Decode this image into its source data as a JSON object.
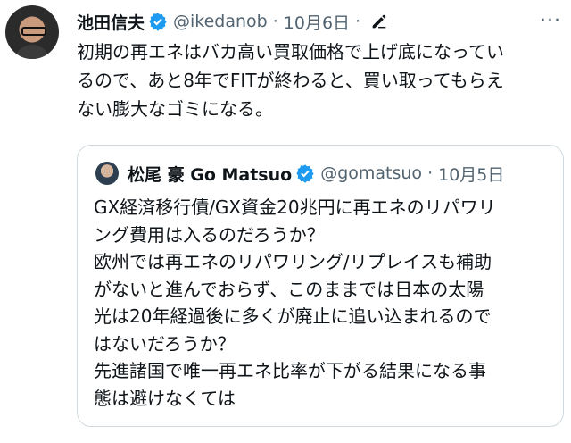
{
  "tweet": {
    "display_name": "池田信夫",
    "handle": "@ikedanob",
    "separator": "·",
    "date": "10月6日",
    "more_label": "···",
    "text_lines": [
      "初期の再エネはバカ高い買取価格で上げ底になってい",
      "るので、あと8年でFITが終わると、買い取ってもらえ",
      "ない膨大なゴミになる。"
    ]
  },
  "quote": {
    "display_name": "松尾 豪 Go Matsuo",
    "handle": "@gomatsuo",
    "separator": "·",
    "date": "10月5日",
    "text_lines": [
      "GX経済移行債/GX資金20兆円に再エネのリパワリ",
      "ング費用は入るのだろうか？",
      "欧州では再エネのリパワリング/リプレイスも補助",
      "がないと進んでおらず、このままでは日本の太陽",
      "光は20年経過後に多くが廃止に追い込まれるので",
      "はないだろうか？",
      "先進諸国で唯一再エネ比率が下がる結果になる事",
      "態は避けなくては"
    ]
  },
  "colors": {
    "verified": "#1d9bf0",
    "text": "#0f1419",
    "muted": "#536471",
    "border": "#cfd9de"
  },
  "icons": {
    "verified": "verified-badge-icon",
    "edit": "edit-pencil-icon",
    "more": "more-dots-icon"
  }
}
